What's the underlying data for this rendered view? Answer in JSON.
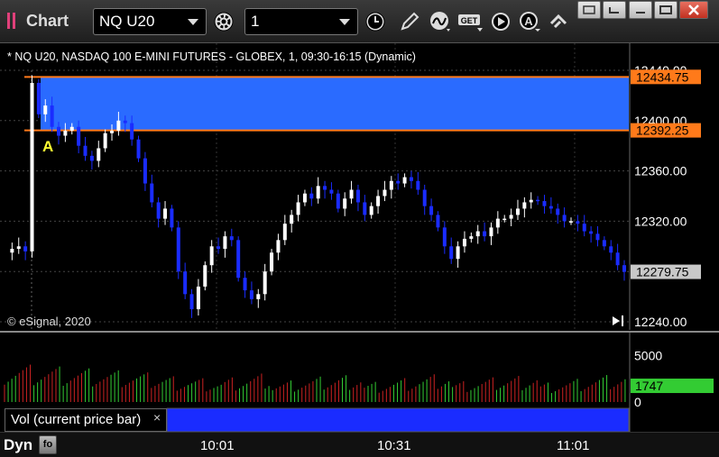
{
  "toolbar": {
    "app_title": "Chart",
    "symbol_value": "NQ U20",
    "interval_value": "1",
    "get_label": "GET",
    "draw_a_label": "A"
  },
  "chart": {
    "title": "* NQ U20, NASDAQ 100 E-MINI FUTURES - GLOBEX, 1, 09:30-16:15 (Dynamic)",
    "copyright": "© eSignal, 2020",
    "marker_label": "A",
    "zone_upper_tag": "12434.75",
    "zone_lower_tag": "12392.25",
    "last_price_tag": "12279.75",
    "price_ticks": [
      "12440.00",
      "12400.00",
      "12360.00",
      "12320.00",
      "12280.00",
      "12240.00"
    ],
    "volume_ticks": [
      "5000",
      "0"
    ],
    "volume_tag": "1747",
    "volume_panel_label": "Vol (current price bar)",
    "volume_close": "×",
    "bottom_label": "Dyn",
    "time_labels": [
      "10:01",
      "10:31",
      "11:01"
    ]
  },
  "colors": {
    "zone_fill": "#2a6bff",
    "zone_line": "#ff7a1a",
    "bull": "#ffffff",
    "bear": "#1a2cff",
    "vol_up": "#33cc33",
    "vol_down": "#cc2222",
    "vol_tag": "#33cc33"
  },
  "chart_data": {
    "type": "candlestick",
    "symbol": "NQ U20",
    "interval": "1 min",
    "ylim": [
      12225,
      12455
    ],
    "zone": [
      12392.25,
      12434.75
    ],
    "last_price": 12279.75,
    "price_path": [
      12295,
      12298,
      12300,
      12296,
      12430,
      12405,
      12412,
      12395,
      12388,
      12392,
      12395,
      12380,
      12372,
      12368,
      12378,
      12390,
      12392,
      12400,
      12398,
      12385,
      12370,
      12350,
      12335,
      12322,
      12330,
      12315,
      12280,
      12262,
      12250,
      12268,
      12285,
      12300,
      12298,
      12308,
      12305,
      12275,
      12265,
      12258,
      12262,
      12280,
      12295,
      12305,
      12318,
      12325,
      12335,
      12342,
      12338,
      12348,
      12345,
      12342,
      12330,
      12338,
      12345,
      12335,
      12325,
      12332,
      12340,
      12345,
      12352,
      12350,
      12355,
      12352,
      12345,
      12332,
      12325,
      12315,
      12300,
      12290,
      12300,
      12306,
      12308,
      12312,
      12308,
      12315,
      12322,
      12322,
      12325,
      12330,
      12335,
      12337,
      12336,
      12332,
      12330,
      12325,
      12320,
      12320,
      12318,
      12312,
      12310,
      12305,
      12300,
      12295,
      12285,
      12279.75
    ],
    "volume_ylim": [
      0,
      7000
    ],
    "last_volume": 1747
  }
}
